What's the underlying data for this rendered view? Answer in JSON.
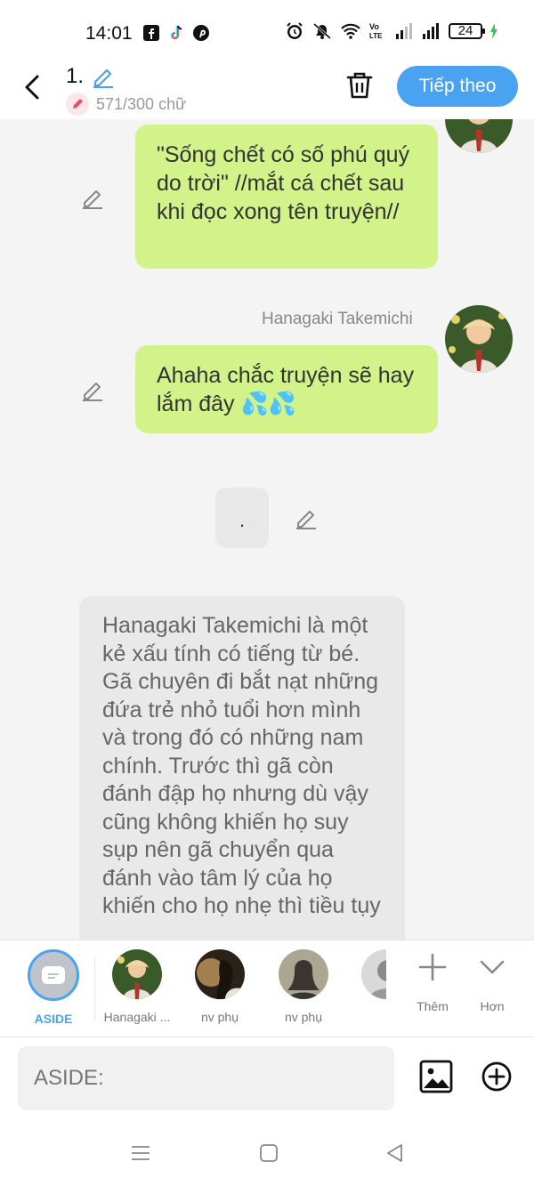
{
  "status_bar": {
    "time": "14:01",
    "battery": "24",
    "app_icons": [
      "facebook-icon",
      "tiktok-icon",
      "pinterest-icon"
    ],
    "indicators": [
      "alarm-icon",
      "mute-icon",
      "wifi-icon",
      "volte-icon",
      "signal-icon",
      "signal-icon"
    ]
  },
  "header": {
    "title": "1.",
    "word_count": "571/300 chữ",
    "next_label": "Tiếp theo"
  },
  "messages": [
    {
      "type": "right",
      "text": "\"Sống chết có số phú quý do trời\" //mắt cá chết sau khi đọc xong tên truyện//"
    },
    {
      "type": "right",
      "sender": "Hanagaki Takemichi",
      "text": "Ahaha chắc truyện sẽ hay lắm đây 💦💦"
    },
    {
      "type": "center",
      "text": "."
    },
    {
      "type": "aside",
      "text": "Hanagaki Takemichi là một kẻ xấu tính có tiếng từ bé. Gã chuyên đi bắt nạt những đứa trẻ nhỏ tuổi hơn mình và trong đó có những nam chính. Trước thì gã còn đánh đập họ nhưng dù vậy cũng không khiến họ suy sụp nên gã chuyển qua đánh vào tâm lý của họ khiến cho họ nhẹ thì tiều tụy"
    }
  ],
  "characters": [
    {
      "label": "ASIDE",
      "selected": true
    },
    {
      "label": "Hanagaki ..."
    },
    {
      "label": "nv phụ"
    },
    {
      "label": "nv phụ"
    },
    {
      "label": ""
    }
  ],
  "tools": {
    "add_label": "Thêm",
    "more_label": "Hơn"
  },
  "composer": {
    "placeholder": "ASIDE:"
  },
  "colors": {
    "accent": "#4aa3f0",
    "bubble": "#d2f28a",
    "aside_bubble": "#e9e9e9"
  }
}
